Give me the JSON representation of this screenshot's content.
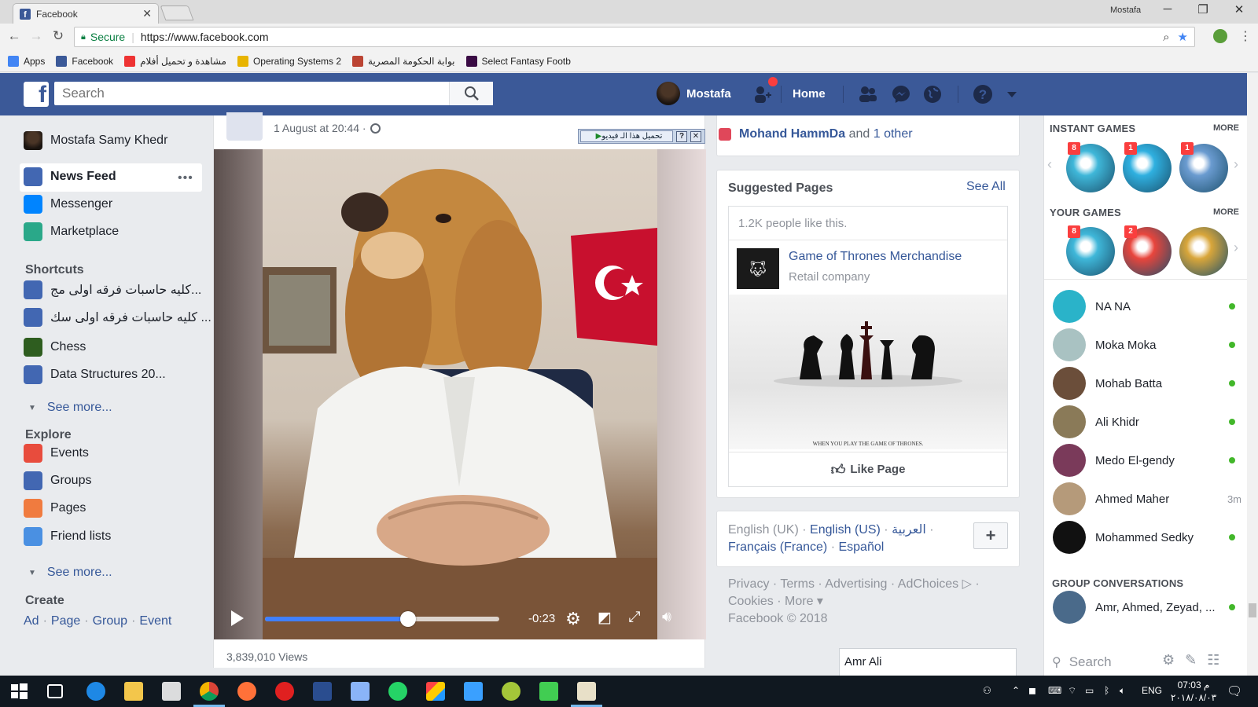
{
  "browser": {
    "tab_title": "Facebook",
    "profile_name": "Mostafa",
    "secure_label": "Secure",
    "url": "https://www.facebook.com",
    "bookmarks": [
      {
        "label": "Apps",
        "icon": "apps-grid-icon",
        "color": "#4285f4"
      },
      {
        "label": "Facebook",
        "icon": "facebook-icon",
        "color": "#3b5998"
      },
      {
        "label": "مشاهدة و تحميل أفلام",
        "icon": "movie-site-icon",
        "color": "#e33"
      },
      {
        "label": "Operating Systems 2",
        "icon": "os-icon",
        "color": "#e8b400"
      },
      {
        "label": "بوابة الحكومة المصرية",
        "icon": "egypt-gov-icon",
        "color": "#b43"
      },
      {
        "label": "Select Fantasy Footb",
        "icon": "fantasy-football-icon",
        "color": "#3a0b44"
      }
    ]
  },
  "fb_header": {
    "search_placeholder": "Search",
    "user_name": "Mostafa",
    "home_label": "Home"
  },
  "left_nav": {
    "profile_name": "Mostafa Samy Khedr",
    "main_items": [
      {
        "label": "News Feed",
        "icon": "news-feed-icon",
        "color": "#4267b2"
      },
      {
        "label": "Messenger",
        "icon": "messenger-icon",
        "color": "#0084ff"
      },
      {
        "label": "Marketplace",
        "icon": "marketplace-icon",
        "color": "#2aa889"
      }
    ],
    "shortcuts_title": "Shortcuts",
    "shortcuts": [
      {
        "label": "كليه حاسبات فرقه اولى مج...",
        "icon": "group-icon"
      },
      {
        "label": "كليه حاسبات فرقه اولى سك ...",
        "icon": "group-icon"
      },
      {
        "label": "Chess",
        "icon": "chess-icon"
      },
      {
        "label": "Data Structures 20...",
        "icon": "group-icon"
      }
    ],
    "see_more": "See more...",
    "explore_title": "Explore",
    "explore": [
      {
        "label": "Events",
        "icon": "events-calendar-icon",
        "color": "#e84c3d"
      },
      {
        "label": "Groups",
        "icon": "groups-icon",
        "color": "#4267b2"
      },
      {
        "label": "Pages",
        "icon": "pages-flag-icon",
        "color": "#f07b3f"
      },
      {
        "label": "Friend lists",
        "icon": "friend-lists-icon",
        "color": "#4a90e2"
      }
    ],
    "see_more_2": "See more...",
    "create_title": "Create",
    "create_links": [
      "Ad",
      "Page",
      "Group",
      "Event"
    ]
  },
  "post": {
    "date": "1 August at 20:44 ·",
    "download_label": "تحميل هذا الـ فيديو",
    "video_time": "-0:23",
    "video_progress": 0.61,
    "views": "3,839,010 Views"
  },
  "right_column": {
    "liked_by_name": "Mohand HammDa",
    "liked_by_and": "and",
    "liked_by_other": "1 other",
    "suggested_title": "Suggested Pages",
    "see_all": "See All",
    "page_likes": "1.2K people like this.",
    "page_name": "Game of Thrones Merchandise",
    "page_category": "Retail company",
    "page_image_caption": "WHEN YOU PLAY THE GAME OF THRONES.",
    "like_page": "Like Page",
    "languages": {
      "current": "English (UK)",
      "others": [
        "English (US)",
        "العربية",
        "Français (France)",
        "Español"
      ]
    },
    "footer_links": [
      "Privacy",
      "Terms",
      "Advertising",
      "AdChoices",
      "Cookies",
      "More"
    ],
    "copyright": "Facebook © 2018",
    "chat_tab_name": "Amr Ali"
  },
  "chat_sidebar": {
    "instant_games_title": "INSTANT GAMES",
    "your_games_title": "YOUR GAMES",
    "more": "MORE",
    "instant_games": [
      {
        "badge": "8",
        "color": "#3fb7d9"
      },
      {
        "badge": "1",
        "color": "#2fb0e0"
      },
      {
        "badge": "1",
        "color": "#6a9bd0"
      }
    ],
    "your_games": [
      {
        "badge": "8",
        "color": "#3fb7d9"
      },
      {
        "badge": "2",
        "color": "#e8453c"
      },
      {
        "badge": "",
        "color": "#d9a63a"
      }
    ],
    "contacts": [
      {
        "name": "NA NA",
        "status": "online",
        "color": "#2ab3c9"
      },
      {
        "name": "Moka Moka",
        "status": "online",
        "color": "#a9c2c2"
      },
      {
        "name": "Mohab Batta",
        "status": "online",
        "color": "#6b4e3a"
      },
      {
        "name": "Ali Khidr",
        "status": "online",
        "color": "#8a7a58"
      },
      {
        "name": "Medo El-gendy",
        "status": "online",
        "color": "#7a3a5a"
      },
      {
        "name": "Ahmed Maher",
        "status": "3m",
        "color": "#b59a7a"
      },
      {
        "name": "Mohammed Sedky",
        "status": "online",
        "color": "#111111"
      }
    ],
    "group_conversations_title": "GROUP CONVERSATIONS",
    "group_conversations": [
      {
        "name": "Amr, Ahmed, Zeyad, ...",
        "status": "online",
        "color": "#4a6a8a"
      }
    ],
    "search_placeholder": "Search"
  },
  "taskbar": {
    "language": "ENG",
    "time": "07:03 م",
    "date": "٢٠١٨/٠٨/٠٣"
  }
}
